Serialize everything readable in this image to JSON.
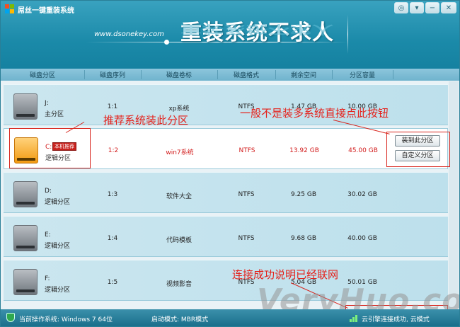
{
  "app": {
    "title": "屌丝一键重装系统"
  },
  "banner": {
    "url": "www.dsonekey.com",
    "slogan": "重装系统不求人"
  },
  "columns": [
    "磁盘分区",
    "磁盘序列",
    "磁盘卷标",
    "磁盘格式",
    "剩余空间",
    "分区容量"
  ],
  "rows": [
    {
      "letter": "J:",
      "type": "主分区",
      "seq": "1:1",
      "label": "xp系统",
      "fs": "NTFS",
      "free": "1.47 GB",
      "size": "10.00 GB",
      "color": "gray",
      "badge": ""
    },
    {
      "letter": "C:",
      "type": "逻辑分区",
      "seq": "1:2",
      "label": "win7系统",
      "fs": "NTFS",
      "free": "13.92 GB",
      "size": "45.00 GB",
      "color": "orange",
      "badge": "本机推荐"
    },
    {
      "letter": "D:",
      "type": "逻辑分区",
      "seq": "1:3",
      "label": "软件大全",
      "fs": "NTFS",
      "free": "9.25 GB",
      "size": "30.02 GB",
      "color": "gray",
      "badge": ""
    },
    {
      "letter": "E:",
      "type": "逻辑分区",
      "seq": "1:4",
      "label": "代码模板",
      "fs": "NTFS",
      "free": "9.68 GB",
      "size": "40.00 GB",
      "color": "gray",
      "badge": ""
    },
    {
      "letter": "F:",
      "type": "逻辑分区",
      "seq": "1:5",
      "label": "视频影音",
      "fs": "NTFS",
      "free": "5.04 GB",
      "size": "50.01 GB",
      "color": "gray",
      "badge": ""
    }
  ],
  "buttons": {
    "install": "装到此分区",
    "custom": "自定义分区"
  },
  "annotations": {
    "recommend": "推荐系统装此分区",
    "button_hint": "一般不是装多系统直接点此按钮",
    "network_hint": "连接成功说明已经联网"
  },
  "status": {
    "os": "当前操作系统: Windows 7 64位",
    "boot": "启动模式: MBR模式",
    "connection": "云引擎连接成功, 云模式"
  },
  "watermark": "VeryHuo.com",
  "colors": {
    "header": "#1b8aa9",
    "accent_red": "#e5211b",
    "status": "#1a6f8b"
  }
}
